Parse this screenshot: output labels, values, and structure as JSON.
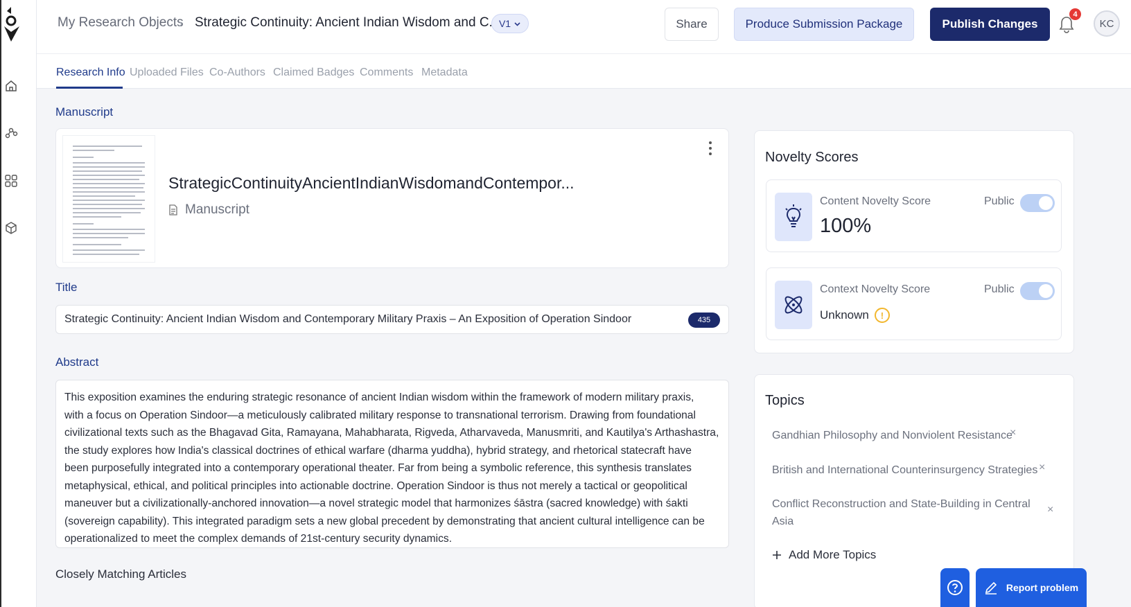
{
  "breadcrumb": {
    "root": "My Research Objects",
    "separator": "›",
    "current": "Strategic Continuity: Ancient Indian Wisdom and C..."
  },
  "version": {
    "label": "V1"
  },
  "header_actions": {
    "share": "Share",
    "produce": "Produce Submission Package",
    "publish": "Publish Changes",
    "notification_count": "4",
    "avatar_initials": "KC"
  },
  "tabs": [
    {
      "label": "Research Info",
      "active": true
    },
    {
      "label": "Uploaded Files"
    },
    {
      "label": "Co-Authors"
    },
    {
      "label": "Claimed Badges"
    },
    {
      "label": "Comments"
    },
    {
      "label": "Metadata"
    }
  ],
  "manuscript": {
    "section_label": "Manuscript",
    "filename": "StrategicContinuityAncientIndianWisdomandContempor...",
    "type": "Manuscript"
  },
  "title_field": {
    "label": "Title",
    "value": "Strategic Continuity: Ancient Indian Wisdom and Contemporary Military Praxis – An Exposition of Operation Sindoor",
    "char_count": "435"
  },
  "abstract": {
    "label": "Abstract",
    "lines": [
      "This exposition examines the enduring strategic resonance of ancient Indian wisdom within the framework of modern military praxis,",
      "with a focus on Operation Sindoor—a meticulously calibrated military response to transnational terrorism. Drawing from foundational",
      "civilizational texts such as the Bhagavad Gita, Ramayana, Mahabharata, Rigveda, Atharvaveda, Manusmriti, and Kautilya's Arthashastra,",
      "the study explores how India's classical doctrines of ethical warfare (dharma yuddha), hybrid strategy, and rhetorical statecraft have",
      "been purposefully integrated into a contemporary operational theater. Far from being a symbolic reference, this synthesis translates",
      "metaphysical, ethical, and political principles into actionable doctrine. Operation Sindoor is thus not merely a tactical or geopolitical",
      "maneuver but a civilizationally-anchored innovation—a novel strategic model that harmonizes śāstra (sacred knowledge) with śakti",
      "(sovereign capability). This integrated paradigm sets a new global precedent by demonstrating that ancient cultural intelligence can be",
      "operationalized to meet the complex demands of 21st-century security dynamics."
    ]
  },
  "closely_matching": {
    "label": "Closely Matching Articles"
  },
  "novelty": {
    "title": "Novelty Scores",
    "content": {
      "label": "Content Novelty Score",
      "value": "100%",
      "public_label": "Public"
    },
    "context": {
      "label": "Context Novelty Score",
      "value": "Unknown",
      "warn_glyph": "!",
      "public_label": "Public"
    }
  },
  "topics": {
    "title": "Topics",
    "items": [
      "Gandhian Philosophy and Nonviolent Resistance",
      "British and International Counterinsurgency Strategies",
      "Conflict Reconstruction and State-Building in Central Asia"
    ],
    "remove_glyph": "×",
    "add_label": "Add More Topics"
  },
  "footer": {
    "report_label": "Report problem"
  },
  "colors": {
    "brand": "#1c2a6b",
    "accent_blue": "#1f5fe0",
    "link": "#1f3a8a",
    "badge_red": "#e53935",
    "warning": "#f2b72e"
  }
}
